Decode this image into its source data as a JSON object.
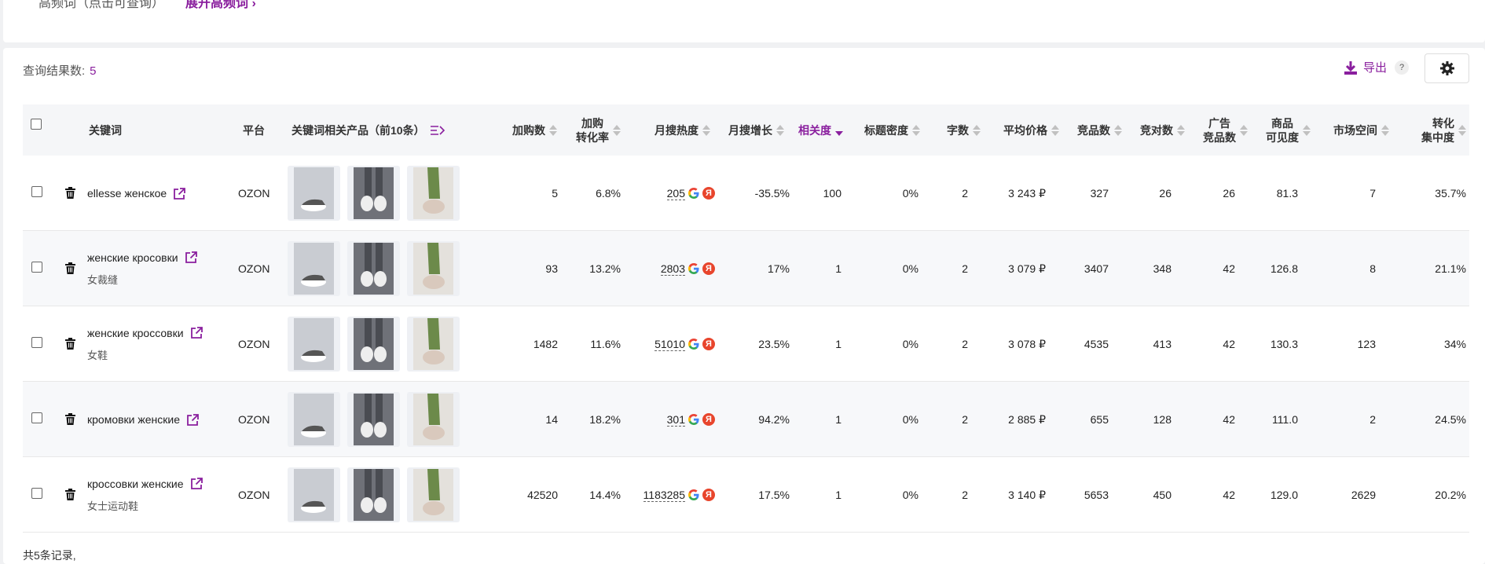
{
  "top": {
    "high_freq_label": "高频词（点击可查询）",
    "expand_link": "展开高频词 ›"
  },
  "toolbar": {
    "result_label": "查询结果数:",
    "result_count": "5",
    "export_label": "导出",
    "help": "?"
  },
  "columns": {
    "keyword": "关键词",
    "platform": "平台",
    "products": "关键词相关产品（前10条）",
    "cart": "加购数",
    "cart_rate_1": "加购",
    "cart_rate_2": "转化率",
    "heat": "月搜热度",
    "growth": "月搜增长",
    "relevance": "相关度",
    "title_density": "标题密度",
    "chars": "字数",
    "avg_price": "平均价格",
    "competitors": "竞品数",
    "rivals": "竞对数",
    "ad_1": "广告",
    "ad_2": "竞品数",
    "vis_1": "商品",
    "vis_2": "可见度",
    "market": "市场空间",
    "conv_1": "转化",
    "conv_2": "集中度"
  },
  "rows": [
    {
      "keyword": "ellesse женское",
      "sub": "",
      "platform": "OZON",
      "cart": "5",
      "cart_rate": "6.8%",
      "heat": "205",
      "growth": "-35.5%",
      "relevance": "100",
      "density": "0%",
      "chars": "2",
      "price": "3 243 ₽",
      "competitors": "327",
      "rivals": "26",
      "ads": "26",
      "visibility": "81.3",
      "market": "7",
      "conv": "35.7%"
    },
    {
      "keyword": "женские кросовки",
      "sub": "女裁缝",
      "platform": "OZON",
      "cart": "93",
      "cart_rate": "13.2%",
      "heat": "2803",
      "growth": "17%",
      "relevance": "1",
      "density": "0%",
      "chars": "2",
      "price": "3 079 ₽",
      "competitors": "3407",
      "rivals": "348",
      "ads": "42",
      "visibility": "126.8",
      "market": "8",
      "conv": "21.1%"
    },
    {
      "keyword": "женские кроссовки",
      "sub": "女鞋",
      "platform": "OZON",
      "cart": "1482",
      "cart_rate": "11.6%",
      "heat": "51010",
      "growth": "23.5%",
      "relevance": "1",
      "density": "0%",
      "chars": "2",
      "price": "3 078 ₽",
      "competitors": "4535",
      "rivals": "413",
      "ads": "42",
      "visibility": "130.3",
      "market": "123",
      "conv": "34%"
    },
    {
      "keyword": "кромовки женские",
      "sub": "",
      "platform": "OZON",
      "cart": "14",
      "cart_rate": "18.2%",
      "heat": "301",
      "growth": "94.2%",
      "relevance": "1",
      "density": "0%",
      "chars": "2",
      "price": "2 885 ₽",
      "competitors": "655",
      "rivals": "128",
      "ads": "42",
      "visibility": "111.0",
      "market": "2",
      "conv": "24.5%"
    },
    {
      "keyword": "кроссовки женские",
      "sub": "女士运动鞋",
      "platform": "OZON",
      "cart": "42520",
      "cart_rate": "14.4%",
      "heat": "1183285",
      "growth": "17.5%",
      "relevance": "1",
      "density": "0%",
      "chars": "2",
      "price": "3 140 ₽",
      "competitors": "5653",
      "rivals": "450",
      "ads": "42",
      "visibility": "129.0",
      "market": "2629",
      "conv": "20.2%"
    }
  ],
  "icons": {
    "google": "G",
    "yandex": "Я"
  },
  "footer": {
    "total": "共5条记录,"
  },
  "colors": {
    "accent": "#8a1f9e",
    "yandex": "#e8452c"
  }
}
